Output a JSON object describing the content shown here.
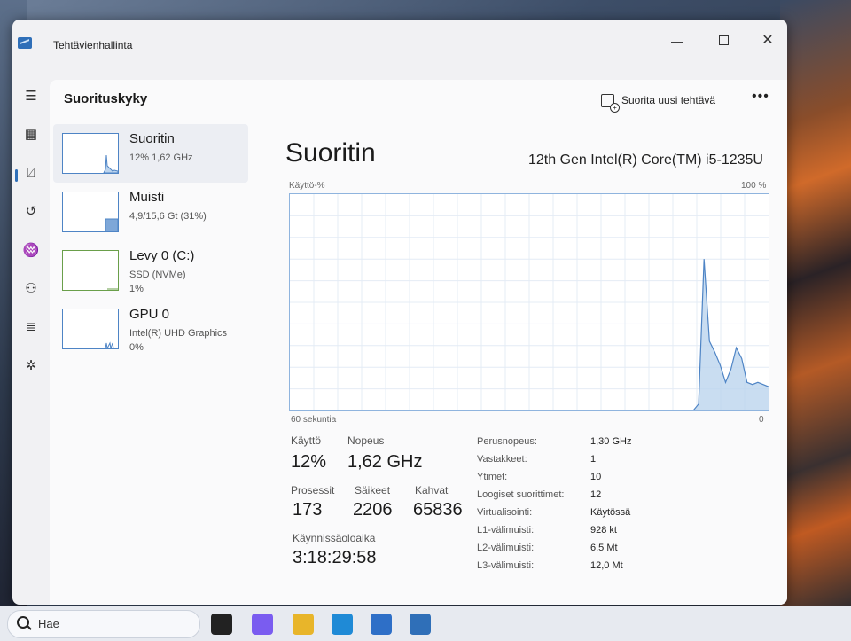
{
  "window": {
    "title": "Tehtävienhallinta",
    "controls": {
      "minimize": "—",
      "close": "✕"
    }
  },
  "nav": {
    "items": [
      {
        "name": "menu-icon",
        "glyph": "☰"
      },
      {
        "name": "processes-icon",
        "glyph": "▦"
      },
      {
        "name": "performance-icon",
        "glyph": "⍁"
      },
      {
        "name": "app-history-icon",
        "glyph": "↺"
      },
      {
        "name": "startup-apps-icon",
        "glyph": "♒"
      },
      {
        "name": "users-icon",
        "glyph": "⚇"
      },
      {
        "name": "details-icon",
        "glyph": "≣"
      },
      {
        "name": "services-icon",
        "glyph": "✲"
      }
    ],
    "settings_glyph": "⚙"
  },
  "header": {
    "page_title": "Suorituskyky",
    "run_task": "Suorita uusi tehtävä",
    "more": "•••"
  },
  "devices": [
    {
      "name": "Suoritin",
      "line1": "12% 1,62 GHz",
      "line2": ""
    },
    {
      "name": "Muisti",
      "line1": "4,9/15,6 Gt (31%)",
      "line2": ""
    },
    {
      "name": "Levy 0 (C:)",
      "line1": "SSD (NVMe)",
      "line2": "1%"
    },
    {
      "name": "GPU 0",
      "line1": "Intel(R) UHD Graphics",
      "line2": "0%"
    }
  ],
  "cpu": {
    "title": "Suoritin",
    "model": "12th Gen Intel(R) Core(TM) i5-1235U",
    "axis_label": "Käyttö-%",
    "axis_max": "100 %",
    "axis_time": "60 sekuntia",
    "axis_zero": "0",
    "graph_series": [
      0,
      0,
      0,
      0,
      0,
      0,
      0,
      0,
      0,
      0,
      0,
      0,
      0,
      0,
      0,
      0,
      0,
      0,
      0,
      0,
      0,
      0,
      0,
      0,
      0,
      0,
      0,
      0,
      0,
      0,
      0,
      0,
      0,
      0,
      0,
      0,
      0,
      0,
      0,
      0,
      0,
      0,
      0,
      0,
      0,
      0,
      0,
      0,
      0,
      0,
      0,
      0,
      0,
      0,
      0,
      0,
      0,
      0,
      0,
      0,
      0,
      0,
      0,
      0,
      0,
      0,
      0,
      0,
      0,
      0,
      0,
      0,
      0,
      0,
      0,
      0,
      3,
      70,
      32,
      27,
      21,
      13,
      19,
      29,
      24,
      13,
      12,
      13,
      12,
      11
    ],
    "graph_color": "#4e84c5",
    "stats": {
      "usage_label": "Käyttö",
      "usage_val": "12%",
      "speed_label": "Nopeus",
      "speed_val": "1,62 GHz",
      "proc_label": "Prosessit",
      "proc_val": "173",
      "threads_label": "Säikeet",
      "threads_val": "2206",
      "handles_label": "Kahvat",
      "handles_val": "65836",
      "uptime_label": "Käynnissäoloaika",
      "uptime_val": "3:18:29:58"
    },
    "specs": [
      {
        "k": "Perusnopeus:",
        "v": "1,30 GHz"
      },
      {
        "k": "Vastakkeet:",
        "v": "1"
      },
      {
        "k": "Ytimet:",
        "v": "10"
      },
      {
        "k": "Loogiset suorittimet:",
        "v": "12"
      },
      {
        "k": "Virtualisointi:",
        "v": "Käytössä"
      },
      {
        "k": "L1-välimuisti:",
        "v": "928 kt"
      },
      {
        "k": "L2-välimuisti:",
        "v": "6,5 Mt"
      },
      {
        "k": "L3-välimuisti:",
        "v": "12,0 Mt"
      }
    ]
  },
  "taskbar": {
    "search_placeholder": "Hae",
    "apps": [
      {
        "name": "widgets-icon",
        "color": "#222222"
      },
      {
        "name": "copilot-icon",
        "color": "#7a5cf0"
      },
      {
        "name": "file-explorer-icon",
        "color": "#e8b52a"
      },
      {
        "name": "edge-icon",
        "color": "#1f8ad6"
      },
      {
        "name": "store-icon",
        "color": "#2e6fc7"
      },
      {
        "name": "task-manager-icon",
        "color": "#2f6fb8"
      }
    ]
  }
}
